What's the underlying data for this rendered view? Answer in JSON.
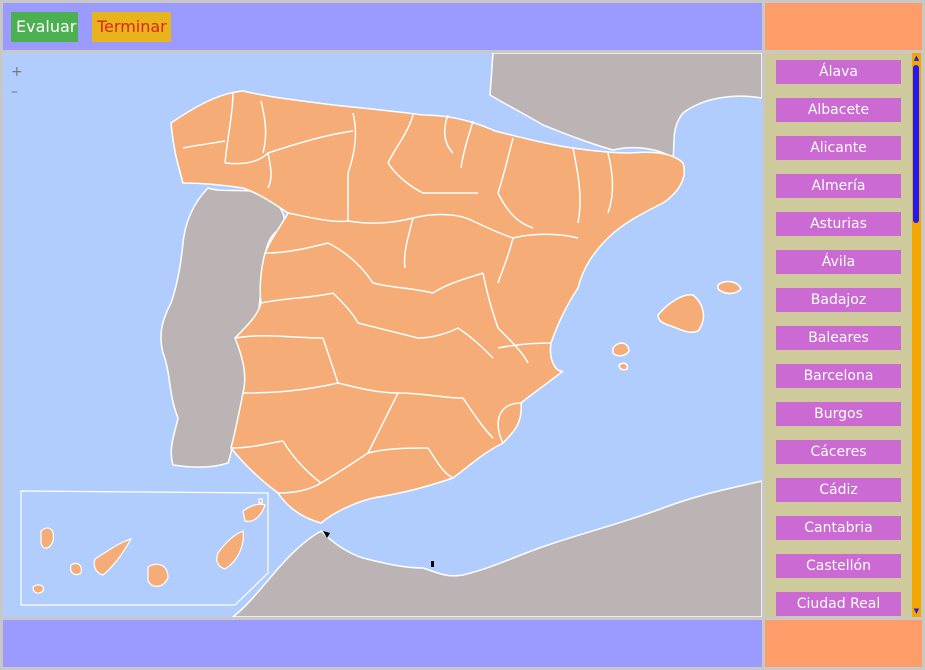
{
  "toolbar": {
    "evaluate_label": "Evaluar",
    "finish_label": "Terminar"
  },
  "map": {
    "zoom_in": "+",
    "zoom_out": "–",
    "colors": {
      "sea": "#b0cdfd",
      "land_foreign": "#bcb4b4",
      "province": "#f5ac76",
      "border": "#ffffff"
    }
  },
  "provinces": [
    {
      "label": "Álava"
    },
    {
      "label": "Albacete"
    },
    {
      "label": "Alicante"
    },
    {
      "label": "Almería"
    },
    {
      "label": "Asturias"
    },
    {
      "label": "Ávila"
    },
    {
      "label": "Badajoz"
    },
    {
      "label": "Baleares"
    },
    {
      "label": "Barcelona"
    },
    {
      "label": "Burgos"
    },
    {
      "label": "Cáceres"
    },
    {
      "label": "Cádiz"
    },
    {
      "label": "Cantabria"
    },
    {
      "label": "Castellón"
    },
    {
      "label": "Ciudad Real"
    }
  ],
  "scrollbar": {
    "up_arrow": "▲",
    "down_arrow": "▼"
  }
}
